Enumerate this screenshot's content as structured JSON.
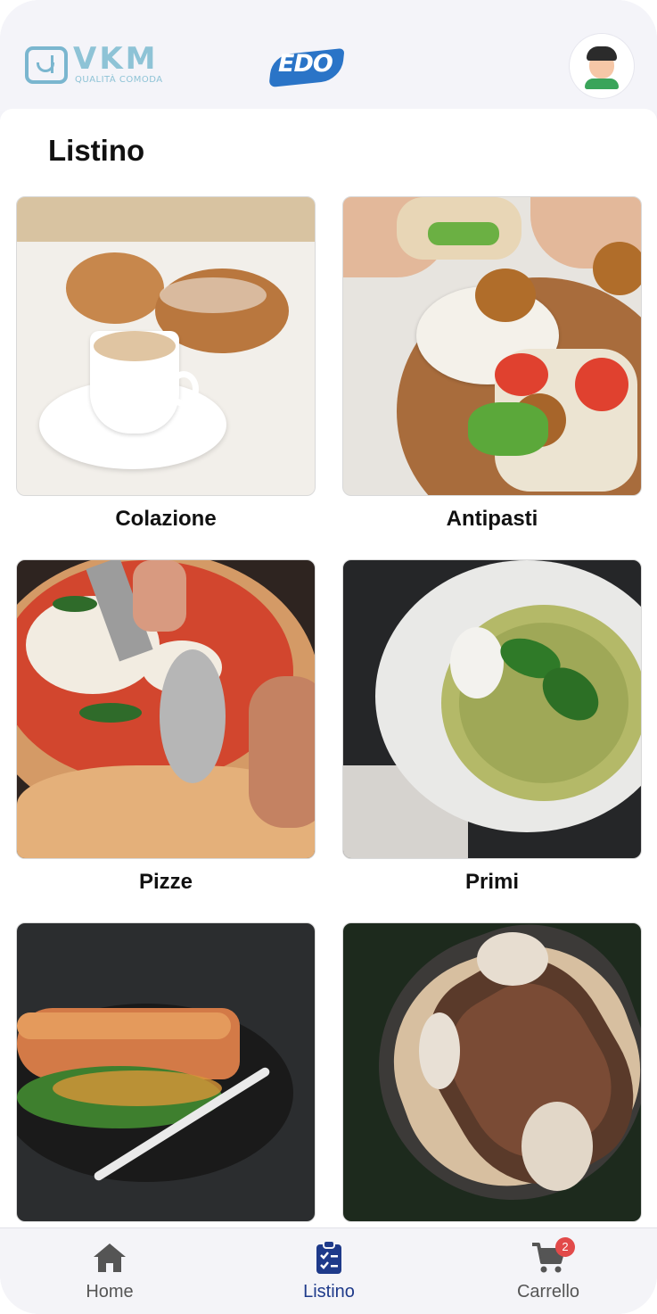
{
  "header": {
    "logo_vkm_text": "VKM",
    "logo_vkm_subtitle": "QUALITÀ COMODA",
    "logo_edo_text": "EDO"
  },
  "page": {
    "title": "Listino"
  },
  "categories": [
    {
      "label": "Colazione",
      "icon": "breakfast-photo"
    },
    {
      "label": "Antipasti",
      "icon": "appetizer-photo"
    },
    {
      "label": "Pizze",
      "icon": "pizza-photo"
    },
    {
      "label": "Primi",
      "icon": "pasta-photo"
    },
    {
      "label": "",
      "icon": "fish-photo"
    },
    {
      "label": "",
      "icon": "meat-photo"
    }
  ],
  "nav": {
    "items": [
      {
        "label": "Home",
        "icon": "home-icon",
        "active": false
      },
      {
        "label": "Listino",
        "icon": "clipboard-list-icon",
        "active": true
      },
      {
        "label": "Carrello",
        "icon": "cart-icon",
        "active": false
      }
    ],
    "cart_badge": "2"
  },
  "colors": {
    "accent": "#1e3a8a",
    "badge": "#e24a4a",
    "logo_blue": "#2a74c7",
    "logo_teal": "#8ec3d6"
  }
}
